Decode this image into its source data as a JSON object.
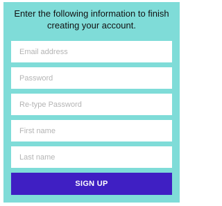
{
  "intro_text": "Enter the following information to finish creating your account.",
  "form": {
    "fields": [
      {
        "placeholder": "Email address",
        "value": ""
      },
      {
        "placeholder": "Password",
        "value": ""
      },
      {
        "placeholder": "Re-type Password",
        "value": ""
      },
      {
        "placeholder": "First name",
        "value": ""
      },
      {
        "placeholder": "Last name",
        "value": ""
      }
    ],
    "submit_label": "SIGN UP"
  },
  "colors": {
    "panel_background": "#7fdcd8",
    "field_background": "#ffffff",
    "button_background": "#3f1fc3",
    "button_text": "#ffffff"
  }
}
